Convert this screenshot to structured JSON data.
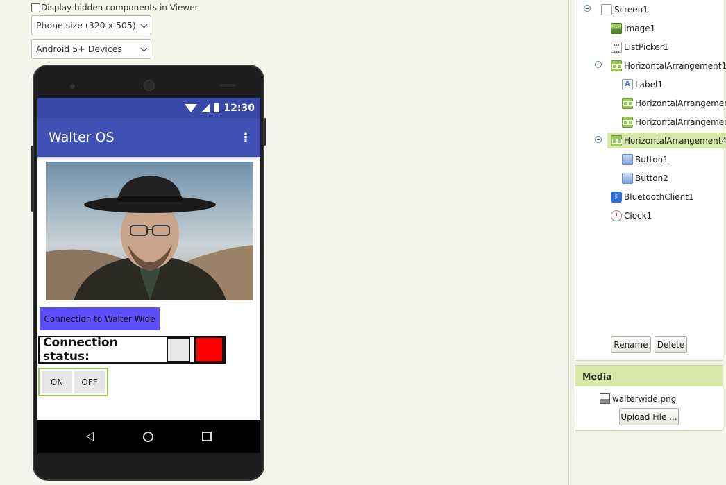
{
  "viewer": {
    "hidden_components_label": "Display hidden components in Viewer",
    "phone_size": "Phone size (320 x 505)",
    "theme": "Android 5+ Devices"
  },
  "phone": {
    "status_time": "12:30",
    "app_title": "Walter OS",
    "menu_icon": "⋮",
    "connect_button": "Connection to Walter Wide",
    "connection_status_label": "Connection status:",
    "on_label": "ON",
    "off_label": "OFF",
    "colors": {
      "appbar": "#3f51b5",
      "statusbar": "#3948a9",
      "connect_button": "#5a4ffa",
      "status_indicator": "#ff0000"
    }
  },
  "components": {
    "items": [
      {
        "label": "Screen1",
        "icon": "screen-icon"
      },
      {
        "label": "Image1",
        "icon": "image-icon"
      },
      {
        "label": "ListPicker1",
        "icon": "listpicker-icon"
      },
      {
        "label": "HorizontalArrangement1",
        "icon": "horizontal-arrangement-icon"
      },
      {
        "label": "Label1",
        "icon": "label-icon"
      },
      {
        "label": "HorizontalArrangemen",
        "icon": "horizontal-arrangement-icon"
      },
      {
        "label": "HorizontalArrangemen",
        "icon": "horizontal-arrangement-icon"
      },
      {
        "label": "HorizontalArrangement4",
        "icon": "horizontal-arrangement-icon",
        "selected": true
      },
      {
        "label": "Button1",
        "icon": "button-icon"
      },
      {
        "label": "Button2",
        "icon": "button-icon"
      },
      {
        "label": "BluetoothClient1",
        "icon": "bluetooth-icon"
      },
      {
        "label": "Clock1",
        "icon": "clock-icon"
      }
    ],
    "rename_label": "Rename",
    "delete_label": "Delete"
  },
  "media": {
    "title": "Media",
    "file": "walterwide.png",
    "upload_label": "Upload File ..."
  }
}
